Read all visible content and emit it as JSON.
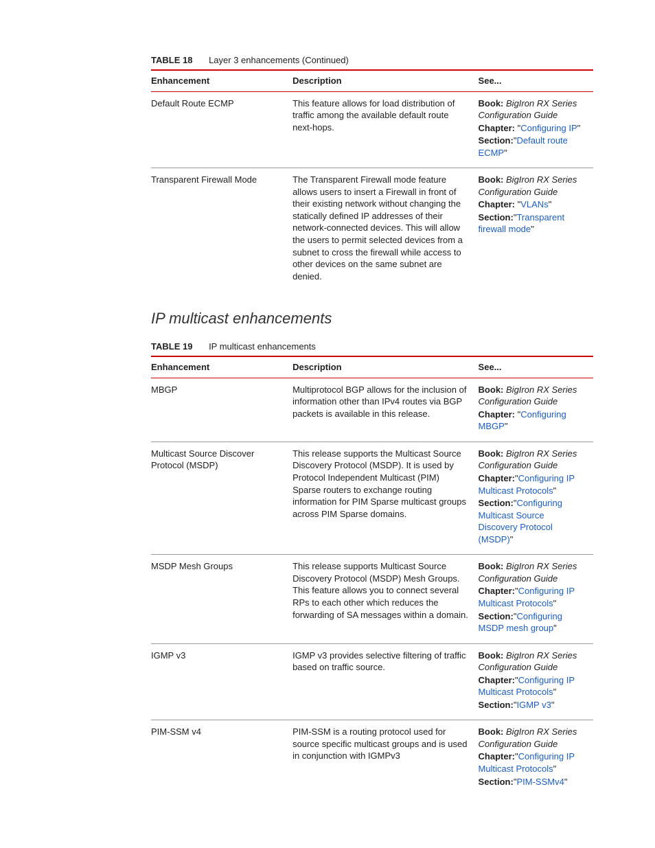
{
  "table18": {
    "number": "TABLE 18",
    "title": "Layer 3 enhancements (Continued)",
    "headers": {
      "c1": "Enhancement",
      "c2": "Description",
      "c3": "See..."
    },
    "rows": [
      {
        "enh": "Default Route ECMP",
        "desc": "This feature allows for load distribution of traffic among the available default route next-hops.",
        "see": {
          "bookLabel": "Book:",
          "book": "BigIron RX Series Configuration Guide",
          "chapterLabel": "Chapter:",
          "chapterQ1": " \"",
          "chapterLink": "Configuring IP",
          "chapterQ2": "\"",
          "sectionLabel": "Section:",
          "sectionQ1": "\"",
          "sectionLink": "Default route ECMP",
          "sectionQ2": "\""
        }
      },
      {
        "enh": "Transparent Firewall Mode",
        "desc": "The Transparent Firewall mode feature allows users to insert a Firewall in front of their existing network without changing the statically defined IP addresses of their network-connected devices. This will allow the users to permit selected devices from a subnet to cross the firewall while access to other devices on the same subnet are denied.",
        "see": {
          "bookLabel": "Book:",
          "book": "BigIron RX Series Configuration Guide",
          "chapterLabel": "Chapter:",
          "chapterQ1": " \"",
          "chapterLink": "VLANs",
          "chapterQ2": "\"",
          "sectionLabel": "Section:",
          "sectionQ1": "\"",
          "sectionLink": "Transparent firewall mode",
          "sectionQ2": "\""
        }
      }
    ]
  },
  "sectionTitle": "IP multicast enhancements",
  "table19": {
    "number": "TABLE 19",
    "title": "IP multicast enhancements",
    "headers": {
      "c1": "Enhancement",
      "c2": "Description",
      "c3": "See..."
    },
    "rows": [
      {
        "enh": "MBGP",
        "desc": "Multiprotocol BGP allows for the inclusion of information other than IPv4 routes via BGP packets is available in this release.",
        "see": {
          "bookLabel": "Book:",
          "book": "BigIron RX Series Configuration Guide",
          "chapterLabel": "Chapter:",
          "chapterQ1": " \"",
          "chapterLink": "Configuring MBGP",
          "chapterQ2": "\"",
          "sectionLabel": "",
          "sectionQ1": "",
          "sectionLink": "",
          "sectionQ2": ""
        }
      },
      {
        "enh": "Multicast Source Discover Protocol (MSDP)",
        "desc": "This release supports the Multicast Source Discovery Protocol (MSDP). It is used by Protocol Independent Multicast (PIM) Sparse routers to exchange routing information for PIM Sparse multicast groups across PIM Sparse domains.",
        "see": {
          "bookLabel": "Book:",
          "book": "BigIron RX Series Configuration Guide",
          "chapterLabel": "Chapter:",
          "chapterQ1": "\"",
          "chapterLink": "Configuring IP Multicast Protocols",
          "chapterQ2": "\"",
          "sectionLabel": "Section:",
          "sectionQ1": "\"",
          "sectionLink": "Configuring Multicast Source Discovery Protocol (MSDP)",
          "sectionQ2": "\""
        }
      },
      {
        "enh": "MSDP Mesh Groups",
        "desc": "This release supports Multicast Source Discovery Protocol (MSDP) Mesh Groups. This feature allows you to connect several RPs to each other which reduces the forwarding of SA messages within a domain.",
        "see": {
          "bookLabel": "Book:",
          "book": "BigIron RX Series Configuration Guide",
          "chapterLabel": "Chapter:",
          "chapterQ1": "\"",
          "chapterLink": "Configuring IP Multicast Protocols",
          "chapterQ2": "\"",
          "sectionLabel": "Section:",
          "sectionQ1": "\"",
          "sectionLink": "Configuring MSDP mesh group",
          "sectionQ2": "\""
        }
      },
      {
        "enh": "IGMP v3",
        "desc": "IGMP v3 provides selective filtering of traffic based on traffic source.",
        "see": {
          "bookLabel": "Book:",
          "book": "BigIron RX Series Configuration Guide",
          "chapterLabel": "Chapter:",
          "chapterQ1": "\"",
          "chapterLink": "Configuring IP Multicast Protocols",
          "chapterQ2": "\"",
          "sectionLabel": "Section:",
          "sectionQ1": "\"",
          "sectionLink": "IGMP v3",
          "sectionQ2": "\""
        }
      },
      {
        "enh": "PIM-SSM v4",
        "desc": "PIM-SSM is a routing protocol used for source specific multicast groups and is used in conjunction with IGMPv3",
        "see": {
          "bookLabel": "Book:",
          "book": "BigIron RX Series Configuration Guide",
          "chapterLabel": "Chapter:",
          "chapterQ1": "\"",
          "chapterLink": "Configuring IP Multicast Protocols",
          "chapterQ2": "\"",
          "sectionLabel": "Section:",
          "sectionQ1": "\"",
          "sectionLink": "PIM-SSMv4",
          "sectionQ2": "\""
        }
      }
    ]
  }
}
